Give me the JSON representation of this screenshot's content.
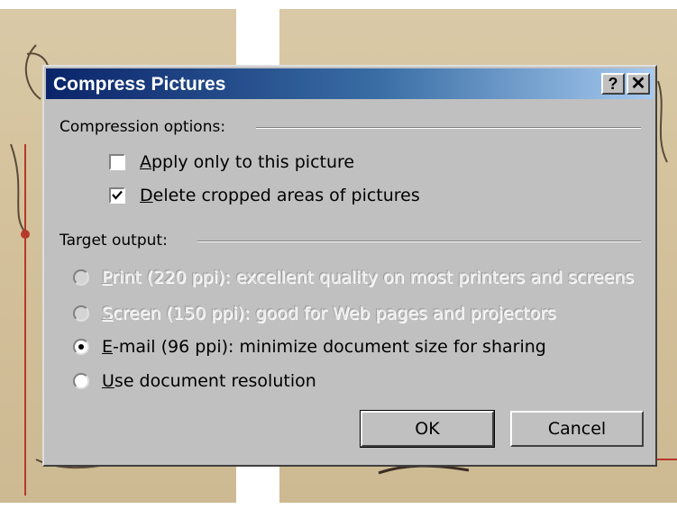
{
  "dialog": {
    "title": "Compress Pictures",
    "help_label": "?",
    "close_label": "✕"
  },
  "compression": {
    "group_label": "Compression options:",
    "options": [
      {
        "accel": "A",
        "rest": "pply only to this picture",
        "checked": false
      },
      {
        "accel": "D",
        "rest": "elete cropped areas of pictures",
        "checked": true
      }
    ]
  },
  "target": {
    "group_label": "Target output:",
    "options": [
      {
        "accel": "P",
        "rest": "rint (220 ppi): excellent quality on most printers and screens",
        "enabled": false,
        "selected": false
      },
      {
        "accel": "S",
        "rest": "creen (150 ppi): good for Web pages and projectors",
        "enabled": false,
        "selected": false
      },
      {
        "accel": "E",
        "rest": "-mail (96 ppi): minimize document size for sharing",
        "enabled": true,
        "selected": true
      },
      {
        "accel": "U",
        "rest": "se document resolution",
        "enabled": true,
        "selected": false
      }
    ]
  },
  "buttons": {
    "ok_label": "OK",
    "cancel_label": "Cancel"
  },
  "colors": {
    "titlebar_start": "#0a246a",
    "titlebar_end": "#a6caf0",
    "dialog_face": "#c0c0c0"
  }
}
